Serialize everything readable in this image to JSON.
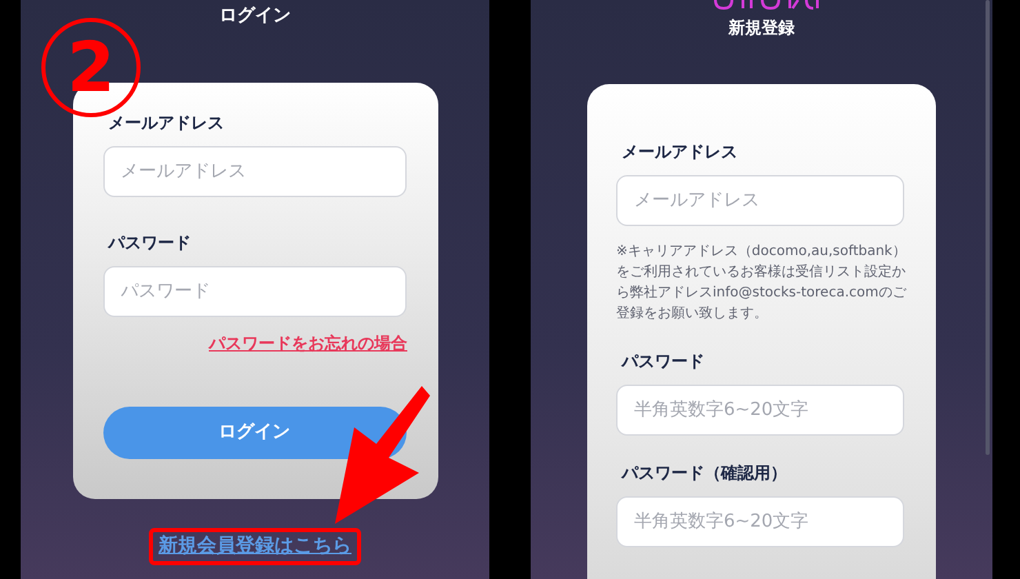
{
  "login_screen": {
    "title": "ログイン",
    "email": {
      "label": "メールアドレス",
      "placeholder": "メールアドレス"
    },
    "password": {
      "label": "パスワード",
      "placeholder": "パスワード"
    },
    "forgot_link": "パスワードをお忘れの場合",
    "login_button": "ログイン",
    "register_link": {
      "text": "新規会員登録はこちら",
      "highlighted": true
    }
  },
  "annotation": {
    "step": "2"
  },
  "signup_screen": {
    "title": "新規登録",
    "fields": [
      {
        "label": "メールアドレス",
        "placeholder": "メールアドレス",
        "note": "※キャリアアドレス（docomo,au,softbank）をご利用されているお客様は受信リスト設定から弊社アドレスinfo@stocks-toreca.comのご登録をお願い致します。"
      },
      {
        "label": "パスワード",
        "placeholder": "半角英数字6~20文字"
      },
      {
        "label": "パスワード（確認用）",
        "placeholder": "半角英数字6~20文字"
      }
    ]
  }
}
